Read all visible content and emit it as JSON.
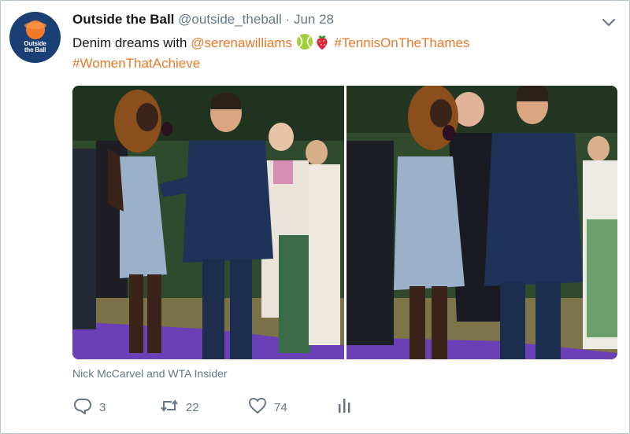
{
  "avatar": {
    "brand_line1": "Outside",
    "brand_line2": "the Ball"
  },
  "header": {
    "name": "Outside the Ball",
    "handle": "@outside_theball",
    "separator": "·",
    "date": "Jun 28"
  },
  "tweet": {
    "text_prefix": "Denim dreams with ",
    "mention": "@serenawilliams",
    "hashtag1": "#TennisOnTheThames",
    "hashtag2": "#WomenThatAchieve",
    "emoji1": "tennis-ball",
    "emoji2": "strawberry"
  },
  "media": {
    "caption": "Nick McCarvel and WTA Insider"
  },
  "actions": {
    "replies": "3",
    "retweets": "22",
    "likes": "74"
  },
  "colors": {
    "link": "#e8792b",
    "muted": "#657786",
    "text": "#14171a",
    "avatar_bg": "#1a3f75"
  }
}
